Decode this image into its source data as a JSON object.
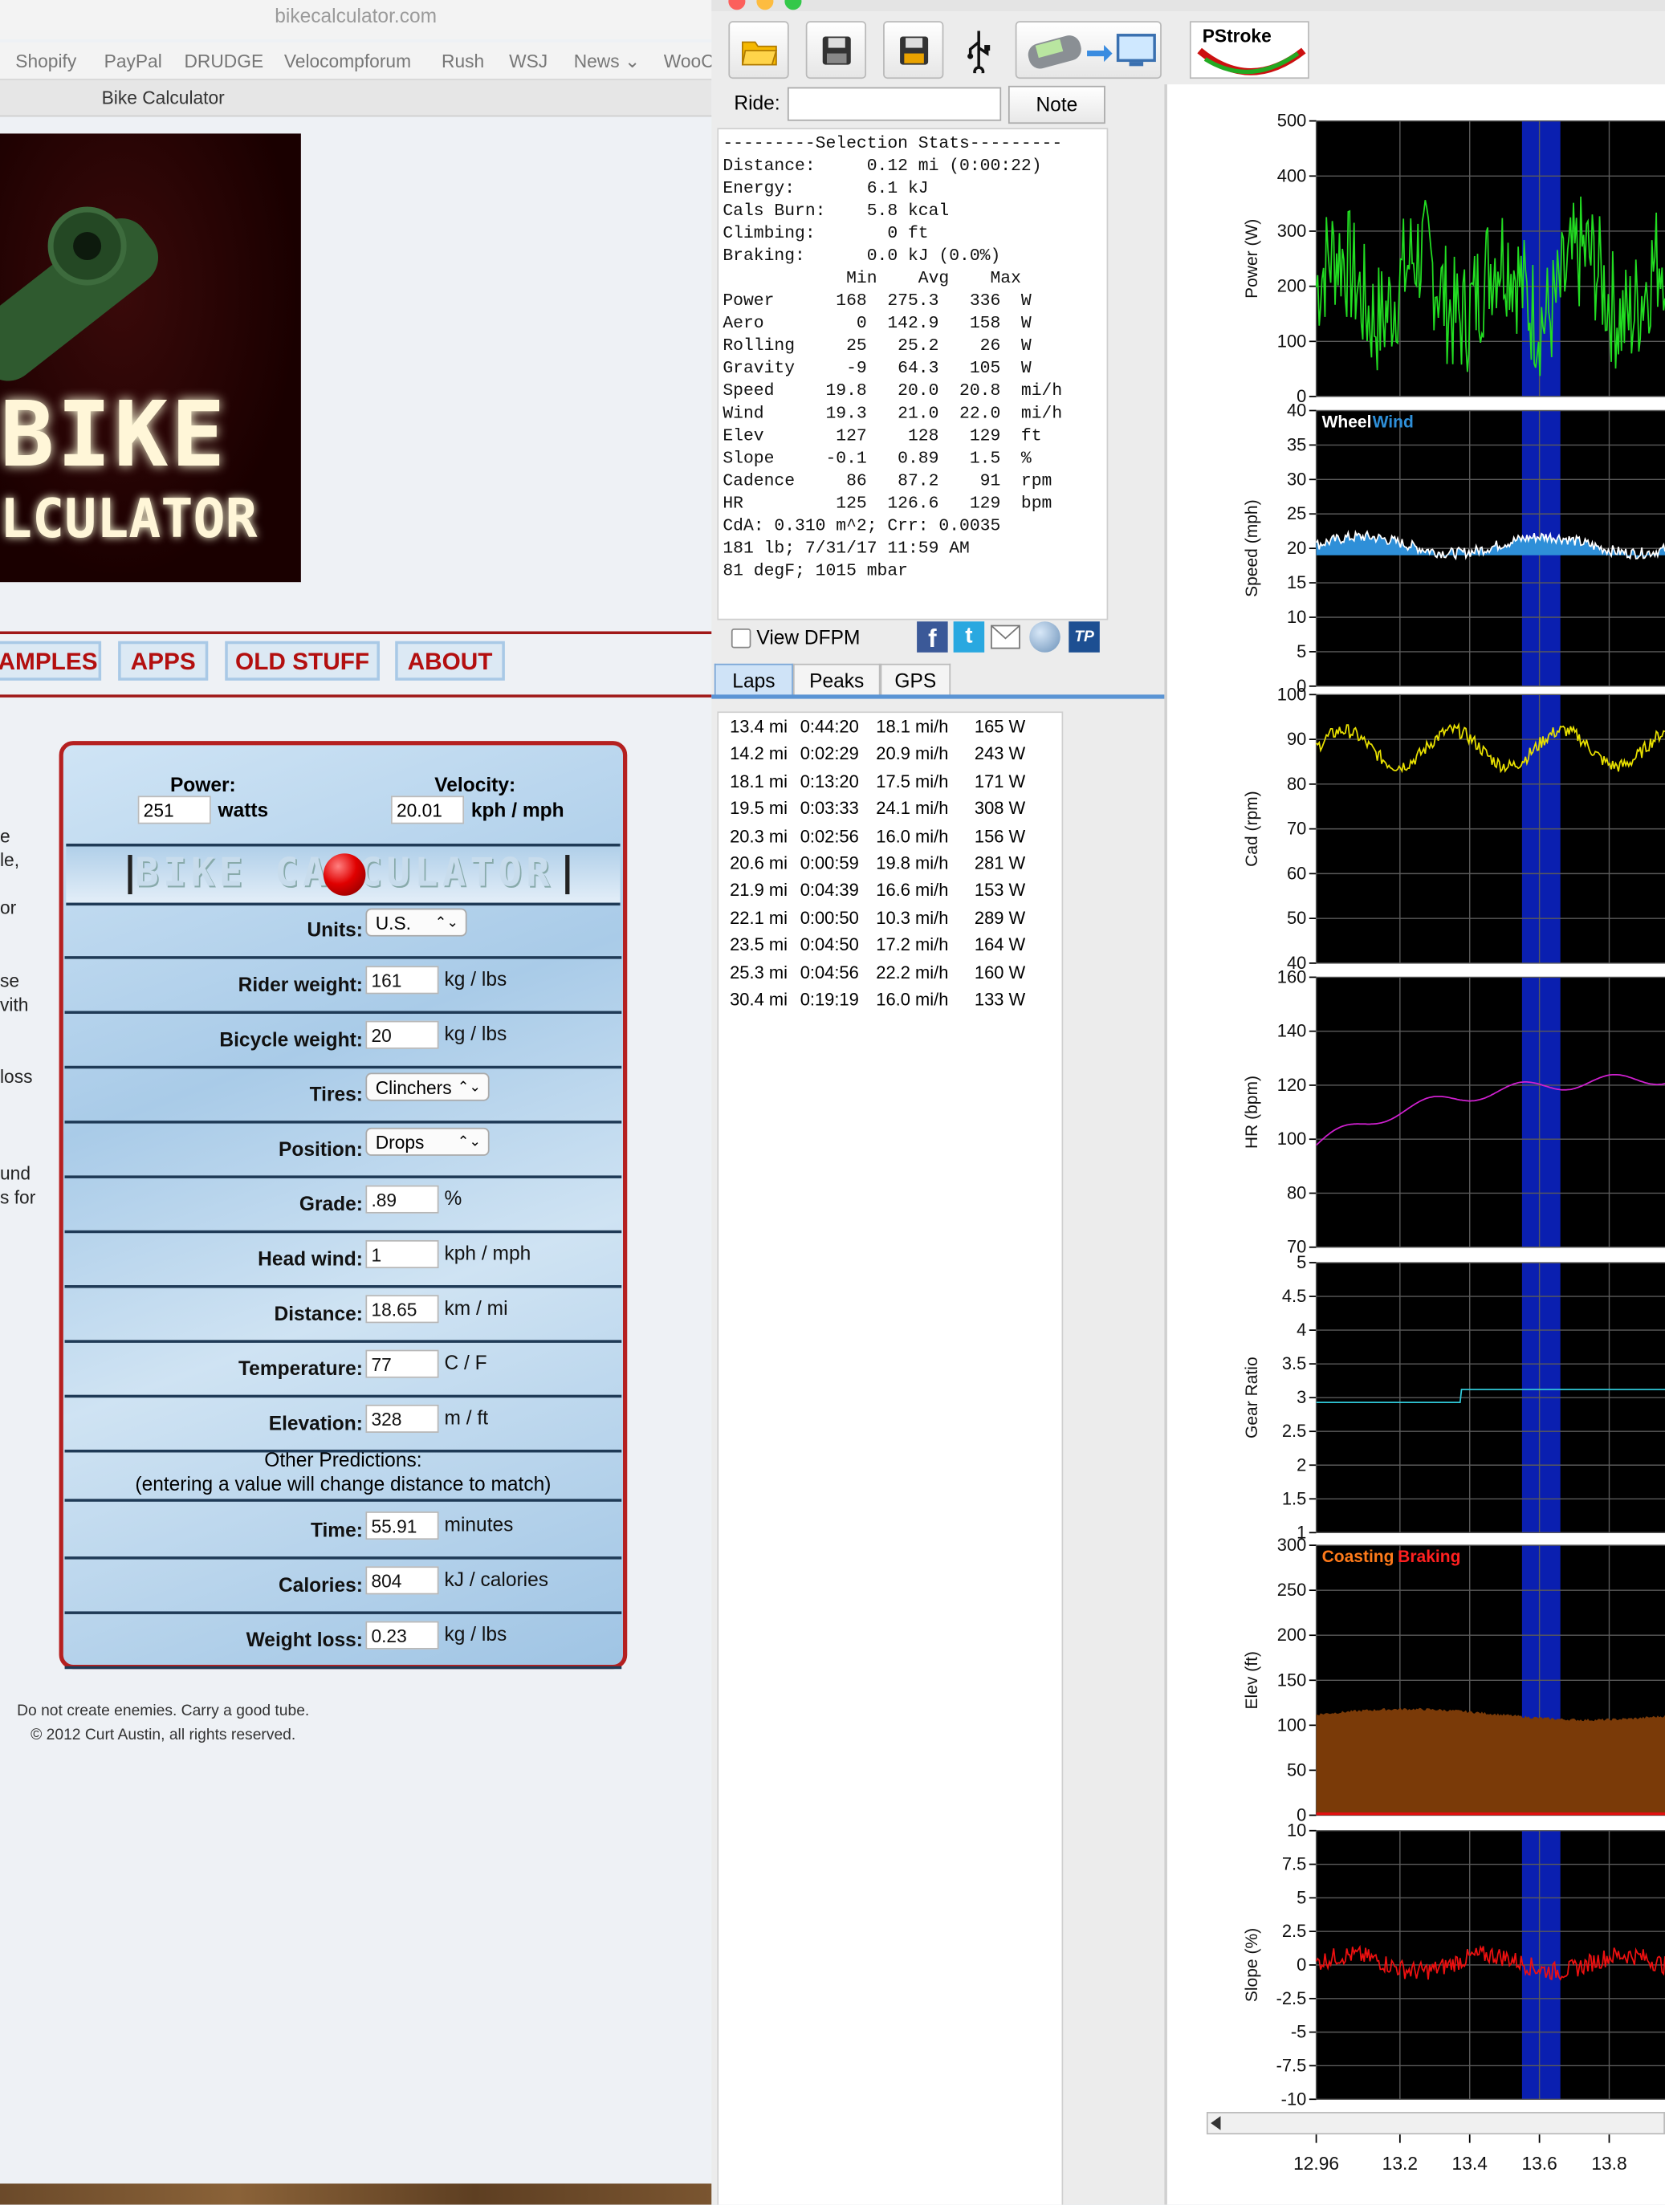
{
  "browser": {
    "url": "bikecalculator.com",
    "bookmarks": [
      "Shopify",
      "PayPal",
      "DRUDGE",
      "Velocompforum",
      "Rush",
      "WSJ",
      "News",
      "WooC"
    ],
    "tab_title": "Bike Calculator"
  },
  "site": {
    "logo_line1": "BIKE",
    "logo_line2": "LCULATOR",
    "nav": [
      "AMPLES",
      "APPS",
      "OLD STUFF",
      "ABOUT"
    ],
    "left_fragments": [
      "e",
      "le,",
      "or",
      "se",
      "vith",
      "loss",
      "und",
      "s for"
    ],
    "footer_line1": "Do not create enemies. Carry a good tube.",
    "footer_line2": "© 2012 Curt Austin, all rights reserved."
  },
  "calculator": {
    "power_label": "Power:",
    "power_value": "251",
    "power_unit": "watts",
    "velocity_label": "Velocity:",
    "velocity_value": "20.01",
    "velocity_unit": "kph / mph",
    "banner_text": "BIKE CALCULATOR",
    "fields": [
      {
        "label": "Units:",
        "value": "U.S.",
        "unit": "",
        "type": "select"
      },
      {
        "label": "Rider weight:",
        "value": "161",
        "unit": "kg / lbs",
        "type": "input"
      },
      {
        "label": "Bicycle weight:",
        "value": "20",
        "unit": "kg / lbs",
        "type": "input"
      },
      {
        "label": "Tires:",
        "value": "Clinchers",
        "unit": "",
        "type": "select"
      },
      {
        "label": "Position:",
        "value": "Drops",
        "unit": "",
        "type": "select"
      },
      {
        "label": "Grade:",
        "value": ".89",
        "unit": "%",
        "type": "input"
      },
      {
        "label": "Head wind:",
        "value": "1",
        "unit": "kph / mph",
        "type": "input"
      },
      {
        "label": "Distance:",
        "value": "18.65",
        "unit": "km / mi",
        "type": "input"
      },
      {
        "label": "Temperature:",
        "value": "77",
        "unit": "C / F",
        "type": "input"
      },
      {
        "label": "Elevation:",
        "value": "328",
        "unit": "m / ft",
        "type": "input"
      }
    ],
    "other_title": "Other Predictions:",
    "other_note": "(entering a value will change distance to match)",
    "predictions": [
      {
        "label": "Time:",
        "value": "55.91",
        "unit": "minutes"
      },
      {
        "label": "Calories:",
        "value": "804",
        "unit": "kJ / calories"
      },
      {
        "label": "Weight loss:",
        "value": "0.23",
        "unit": "kg / lbs"
      }
    ]
  },
  "app": {
    "toolbar": {
      "pstroke_label": "PStroke"
    },
    "ride_label": "Ride:",
    "note_button": "Note",
    "stats_lines": [
      "---------Selection Stats---------",
      "Distance:     0.12 mi (0:00:22)",
      "Energy:       6.1 kJ",
      "Cals Burn:    5.8 kcal",
      "Climbing:       0 ft",
      "Braking:      0.0 kJ (0.0%)",
      "            Min    Avg    Max",
      "Power      168  275.3   336  W",
      "Aero         0  142.9   158  W",
      "Rolling     25   25.2    26  W",
      "Gravity     -9   64.3   105  W",
      "Speed     19.8   20.0  20.8  mi/h",
      "Wind      19.3   21.0  22.0  mi/h",
      "Elev       127    128   129  ft",
      "Slope     -0.1   0.89   1.5  %",
      "Cadence     86   87.2    91  rpm",
      "HR         125  126.6   129  bpm",
      "CdA: 0.310 m^2; Crr: 0.0035",
      "181 lb; 7/31/17 11:59 AM",
      "81 degF; 1015 mbar"
    ],
    "view_dfpm": "View DFPM",
    "tabs": [
      "Laps",
      "Peaks",
      "GPS"
    ],
    "laps": [
      [
        "13.4 mi",
        "0:44:20",
        "18.1 mi/h",
        "165 W"
      ],
      [
        "14.2 mi",
        "0:02:29",
        "20.9 mi/h",
        "243 W"
      ],
      [
        "18.1 mi",
        "0:13:20",
        "17.5 mi/h",
        "171 W"
      ],
      [
        "19.5 mi",
        "0:03:33",
        "24.1 mi/h",
        "308 W"
      ],
      [
        "20.3 mi",
        "0:02:56",
        "16.0 mi/h",
        "156 W"
      ],
      [
        "20.6 mi",
        "0:00:59",
        "19.8 mi/h",
        "281 W"
      ],
      [
        "21.9 mi",
        "0:04:39",
        "16.6 mi/h",
        "153 W"
      ],
      [
        "22.1 mi",
        "0:00:50",
        "10.3 mi/h",
        "289 W"
      ],
      [
        "23.5 mi",
        "0:04:50",
        "17.2 mi/h",
        "164 W"
      ],
      [
        "25.3 mi",
        "0:04:56",
        "22.2 mi/h",
        "160 W"
      ],
      [
        "30.4 mi",
        "0:19:19",
        "16.0 mi/h",
        "133 W"
      ]
    ]
  },
  "chart_data": [
    {
      "type": "line",
      "ylabel": "Power (W)",
      "yticks": [
        "500",
        "400",
        "300",
        "200",
        "100",
        "0"
      ],
      "ylim": [
        0,
        500
      ],
      "series": [
        {
          "color": "#22dd22"
        }
      ]
    },
    {
      "type": "line",
      "ylabel": "Speed (mph)",
      "yticks": [
        "40",
        "35",
        "30",
        "25",
        "20",
        "15",
        "10",
        "5",
        "0"
      ],
      "ylim": [
        0,
        40
      ],
      "legend": [
        "Wheel",
        "Wind"
      ],
      "series": [
        {
          "name": "Wheel",
          "color": "#ffffff"
        },
        {
          "name": "Wind",
          "color": "#2e8fd8"
        }
      ]
    },
    {
      "type": "line",
      "ylabel": "Cad (rpm)",
      "yticks": [
        "100",
        "90",
        "80",
        "70",
        "60",
        "50",
        "40"
      ],
      "ylim": [
        40,
        100
      ],
      "series": [
        {
          "color": "#e8e000"
        }
      ]
    },
    {
      "type": "line",
      "ylabel": "HR (bpm)",
      "yticks": [
        "160",
        "140",
        "120",
        "100",
        "80",
        "70"
      ],
      "ylim": [
        70,
        160
      ],
      "series": [
        {
          "color": "#d020d0"
        }
      ]
    },
    {
      "type": "line",
      "ylabel": "Gear Ratio",
      "yticks": [
        "5",
        "4.5",
        "4",
        "3.5",
        "3",
        "2.5",
        "2",
        "1.5",
        "1"
      ],
      "ylim": [
        1,
        5
      ],
      "series": [
        {
          "color": "#30c8d8"
        }
      ]
    },
    {
      "type": "area",
      "ylabel": "Elev (ft)",
      "yticks": [
        "300",
        "250",
        "200",
        "150",
        "100",
        "50",
        "0"
      ],
      "ylim": [
        0,
        300
      ],
      "legend": [
        "Coasting",
        "Braking"
      ],
      "series": [
        {
          "color": "#7a3a08"
        }
      ]
    },
    {
      "type": "line",
      "ylabel": "Slope (%)",
      "yticks": [
        "10",
        "7.5",
        "5",
        "2.5",
        "0",
        "-2.5",
        "-5",
        "-7.5",
        "-10"
      ],
      "ylim": [
        -10,
        10
      ],
      "series": [
        {
          "color": "#ee1010"
        }
      ]
    }
  ],
  "x_axis": {
    "ticks": [
      "12.96",
      "13.2",
      "13.4",
      "13.6",
      "13.8"
    ],
    "selection": [
      13.55,
      13.66
    ],
    "xlim": [
      12.96,
      13.96
    ]
  }
}
